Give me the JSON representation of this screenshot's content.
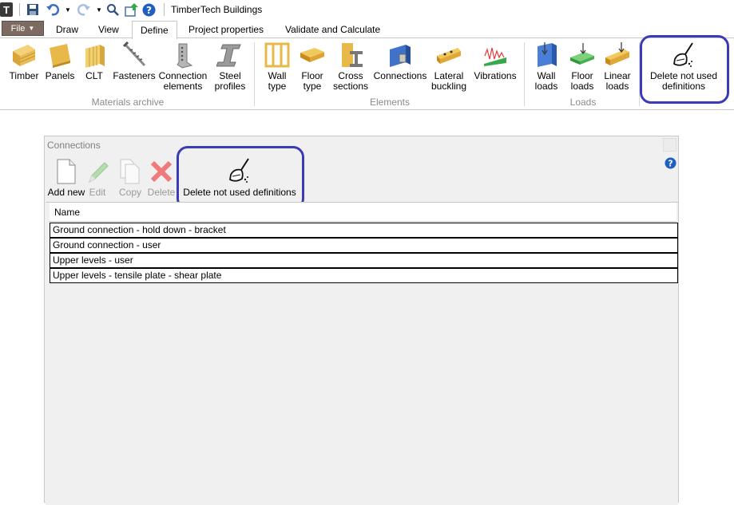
{
  "app": {
    "title": "TimberTech Buildings",
    "logo_letter": "T"
  },
  "tabs": {
    "file": "File",
    "items": [
      "Draw",
      "View",
      "Define",
      "Project properties",
      "Validate and Calculate"
    ]
  },
  "ribbon": {
    "groups": {
      "materials": "Materials archive",
      "elements": "Elements",
      "loads": "Loads"
    },
    "buttons": {
      "timber": "Timber",
      "panels": "Panels",
      "clt": "CLT",
      "fasteners": "Fasteners",
      "connection_elements_1": "Connection",
      "connection_elements_2": "elements",
      "steel_profiles_1": "Steel",
      "steel_profiles_2": "profiles",
      "wall_type_1": "Wall",
      "wall_type_2": "type",
      "floor_type_1": "Floor",
      "floor_type_2": "type",
      "cross_sections_1": "Cross",
      "cross_sections_2": "sections",
      "connections": "Connections",
      "lateral_buckling_1": "Lateral",
      "lateral_buckling_2": "buckling",
      "vibrations": "Vibrations",
      "wall_loads_1": "Wall",
      "wall_loads_2": "loads",
      "floor_loads_1": "Floor",
      "floor_loads_2": "loads",
      "linear_loads_1": "Linear",
      "linear_loads_2": "loads",
      "delete_unused_1": "Delete not used",
      "delete_unused_2": "definitions"
    }
  },
  "dialog": {
    "title": "Connections",
    "toolbar": {
      "add_new": "Add new",
      "edit": "Edit",
      "copy": "Copy",
      "delete": "Delete",
      "delete_unused": "Delete not used definitions"
    },
    "grid": {
      "header": "Name",
      "rows": [
        "Ground connection - hold down - bracket",
        "Ground connection - user",
        "Upper levels - user",
        "Upper levels - tensile plate - shear plate"
      ]
    }
  },
  "colors": {
    "highlight": "#3b3bb8",
    "file_tab": "#7d6b62",
    "timber": "#e6b84a"
  }
}
